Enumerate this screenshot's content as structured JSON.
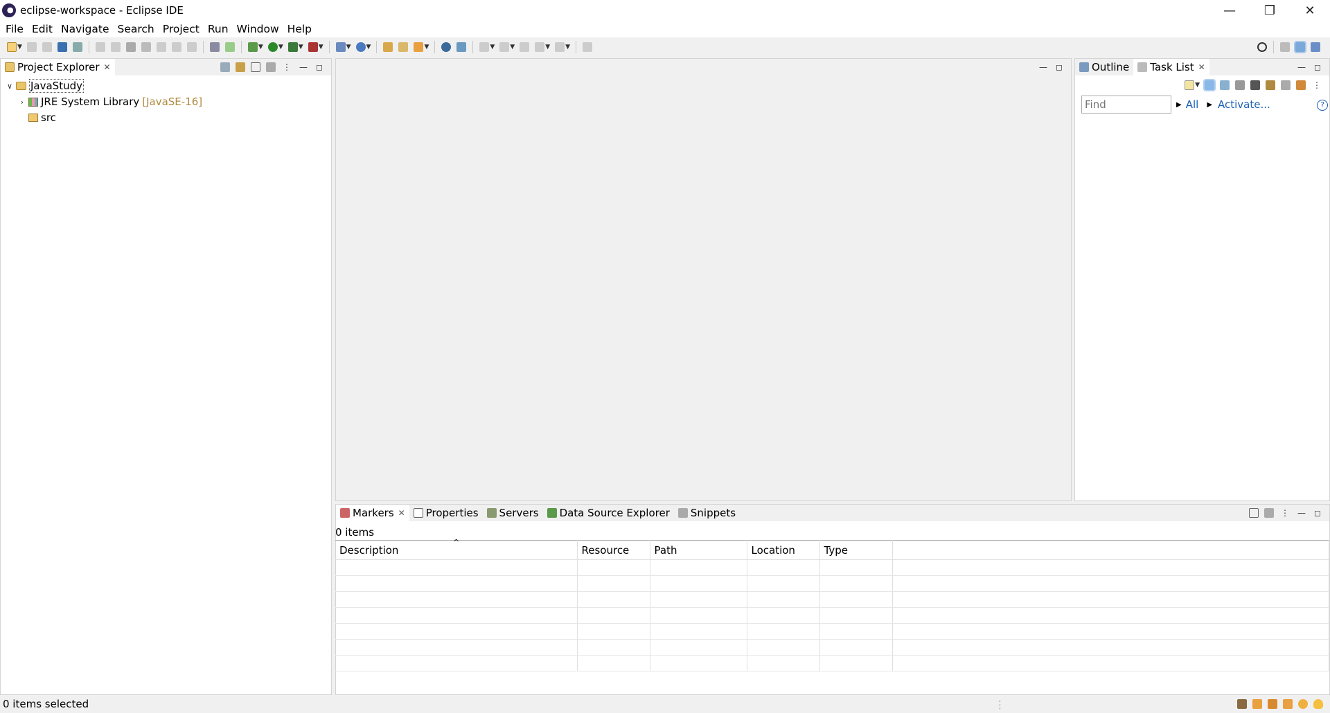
{
  "window": {
    "title": "eclipse-workspace - Eclipse IDE",
    "controls": [
      "minimize-icon",
      "restore-icon",
      "close-icon"
    ]
  },
  "menu": [
    "File",
    "Edit",
    "Navigate",
    "Search",
    "Project",
    "Run",
    "Window",
    "Help"
  ],
  "project_explorer": {
    "tab_label": "Project Explorer",
    "tree": [
      {
        "label": "JavaStudy",
        "expanded": true,
        "depth": 0
      },
      {
        "label": "JRE System Library",
        "decoration": "[JavaSE-16]",
        "expanded": false,
        "depth": 1
      },
      {
        "label": "src",
        "depth": 1
      }
    ]
  },
  "right_panel": {
    "tabs": [
      "Outline",
      "Task List"
    ],
    "find_placeholder": "Find",
    "all_label": "All",
    "activate_label": "Activate...",
    "help_icon": "help-icon"
  },
  "bottom_panel": {
    "tabs": [
      "Markers",
      "Properties",
      "Servers",
      "Data Source Explorer",
      "Snippets"
    ],
    "items_count": "0 items",
    "columns": [
      "Description",
      "Resource",
      "Path",
      "Location",
      "Type"
    ],
    "empty_rows": 7
  },
  "statusbar": {
    "text": "0 items selected"
  },
  "colors": {
    "accent": "#1a5fb4",
    "decoration": "#b08a40"
  }
}
